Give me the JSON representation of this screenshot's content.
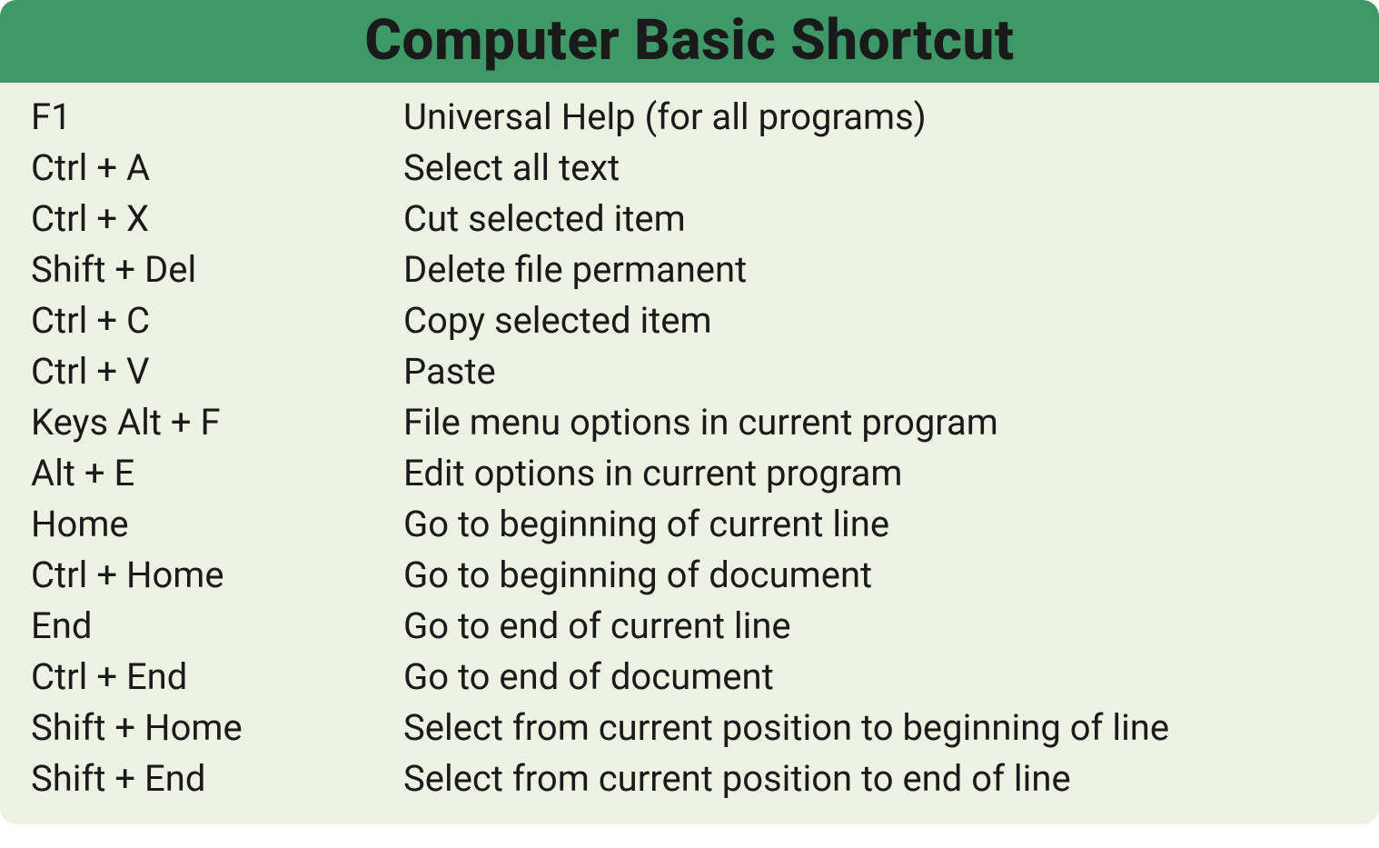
{
  "title": "Computer Basic Shortcut",
  "shortcuts": [
    {
      "key": "F1",
      "desc": "Universal Help (for all programs)"
    },
    {
      "key": "Ctrl + A",
      "desc": "Select all text"
    },
    {
      "key": "Ctrl + X",
      "desc": "Cut selected item"
    },
    {
      "key": "Shift + Del",
      "desc": "Delete file permanent"
    },
    {
      "key": "Ctrl + C",
      "desc": "Copy selected item"
    },
    {
      "key": "Ctrl + V",
      "desc": "Paste"
    },
    {
      "key": "Keys Alt + F",
      "desc": "File menu options in current program"
    },
    {
      "key": "Alt + E",
      "desc": "Edit options in current program"
    },
    {
      "key": "Home",
      "desc": "Go to beginning of current line"
    },
    {
      "key": "Ctrl + Home",
      "desc": "Go to beginning of document"
    },
    {
      "key": "End",
      "desc": "Go to end of current line"
    },
    {
      "key": "Ctrl + End",
      "desc": "Go to end of document"
    },
    {
      "key": "Shift + Home",
      "desc": "Select from current position to beginning of line"
    },
    {
      "key": "Shift + End",
      "desc": "Select from current position to end of line"
    }
  ]
}
